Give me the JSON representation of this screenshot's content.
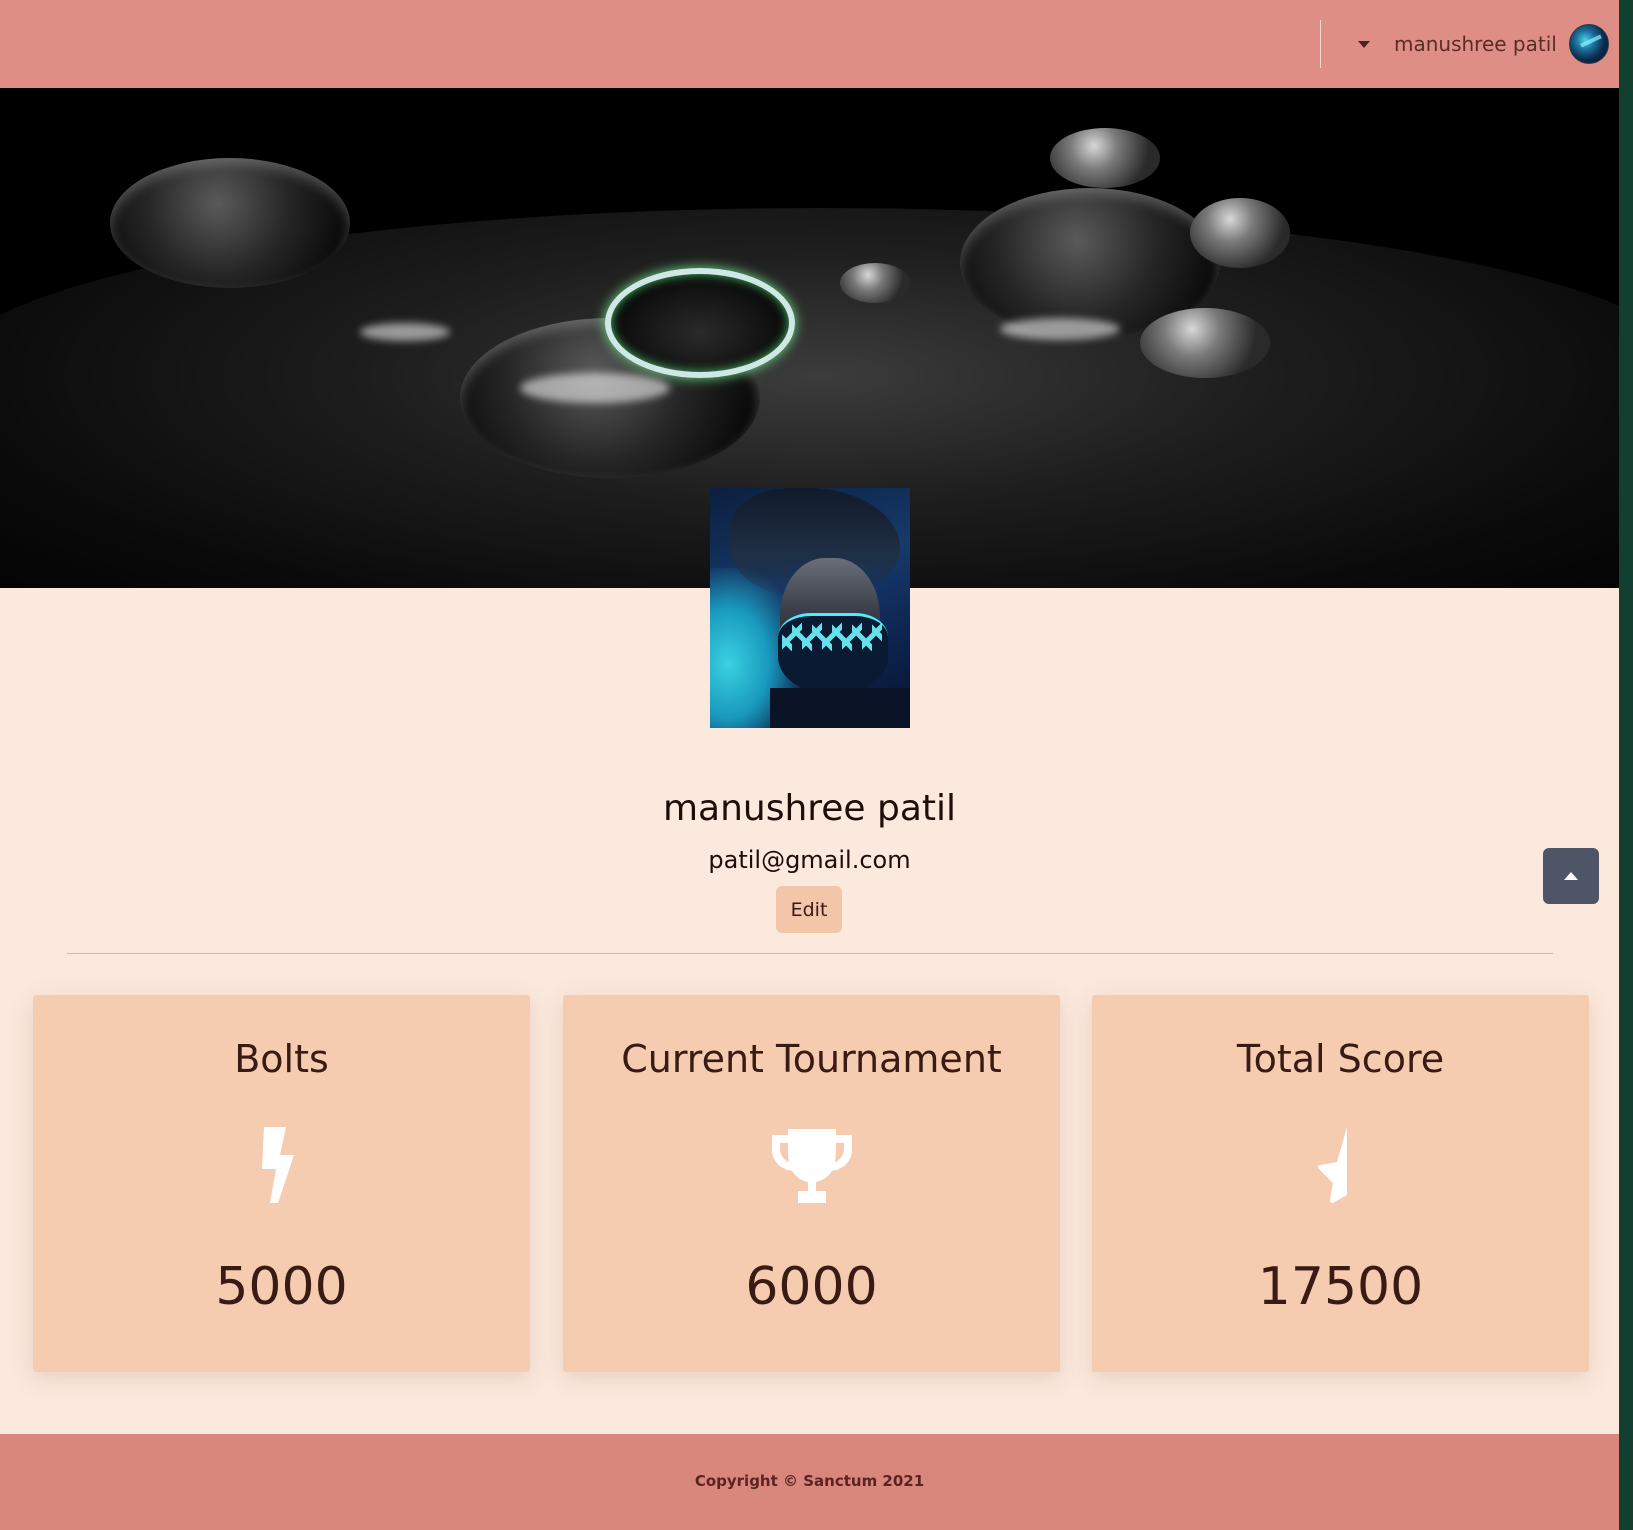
{
  "header": {
    "user_name": "manushree patil",
    "menu_icon": "caret-down-icon",
    "avatar_icon": "user-avatar"
  },
  "profile": {
    "name": "manushree patil",
    "email": "patil@gmail.com",
    "edit_label": "Edit"
  },
  "stats": [
    {
      "title": "Bolts",
      "icon": "bolt-icon",
      "value": "5000"
    },
    {
      "title": "Current Tournament",
      "icon": "trophy-icon",
      "value": "6000"
    },
    {
      "title": "Total Score",
      "icon": "star-half-icon",
      "value": "17500"
    }
  ],
  "footer": {
    "copyright": "Copyright © Sanctum 2021"
  },
  "colors": {
    "topbar": "#de8e84",
    "page_bg": "#fbe9dd",
    "card_bg": "#f5ccb0",
    "footer": "#d9877c",
    "scroll_button": "#4e5566"
  }
}
